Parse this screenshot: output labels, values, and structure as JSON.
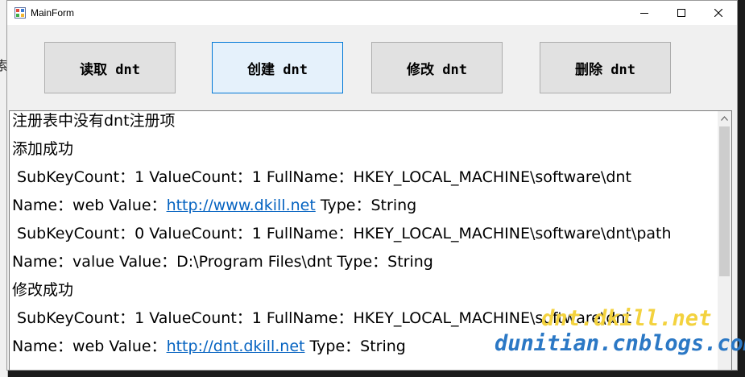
{
  "window": {
    "title": "MainForm"
  },
  "left_fragment": "索",
  "buttons": {
    "read": "读取 dnt",
    "create": "创建 dnt",
    "modify": "修改 dnt",
    "delete": "删除 dnt"
  },
  "output": {
    "lines": [
      {
        "text": "注册表中没有dnt注册项"
      },
      {
        "text": "添加成功"
      },
      {
        "text": " SubKeyCount：1 ValueCount：1 FullName：HKEY_LOCAL_MACHINE\\software\\dnt"
      },
      {
        "before": "Name：web Value：",
        "link": "http://www.dkill.net",
        "after": " Type：String"
      },
      {
        "text": " SubKeyCount：0 ValueCount：1 FullName：HKEY_LOCAL_MACHINE\\software\\dnt\\path"
      },
      {
        "text": "Name：value Value：D:\\Program Files\\dnt Type：String"
      },
      {
        "text": "修改成功"
      },
      {
        "text": " SubKeyCount：1 ValueCount：1 FullName：HKEY_LOCAL_MACHINE\\software\\dnt"
      },
      {
        "before": "Name：web Value：",
        "link": "http://dnt.dkill.net",
        "after": " Type：String"
      }
    ]
  },
  "watermark": {
    "line1": "dnt.dkill.net",
    "line2": "dunitian.cnblogs.com"
  },
  "colors": {
    "link": "#0563c1",
    "focus_border": "#0078d7",
    "watermark_yellow": "#f3d23e",
    "watermark_blue": "#2b78c5"
  },
  "icons": [
    "app-icon",
    "minimize-icon",
    "maximize-icon",
    "close-icon",
    "scroll-up-arrow-icon"
  ]
}
